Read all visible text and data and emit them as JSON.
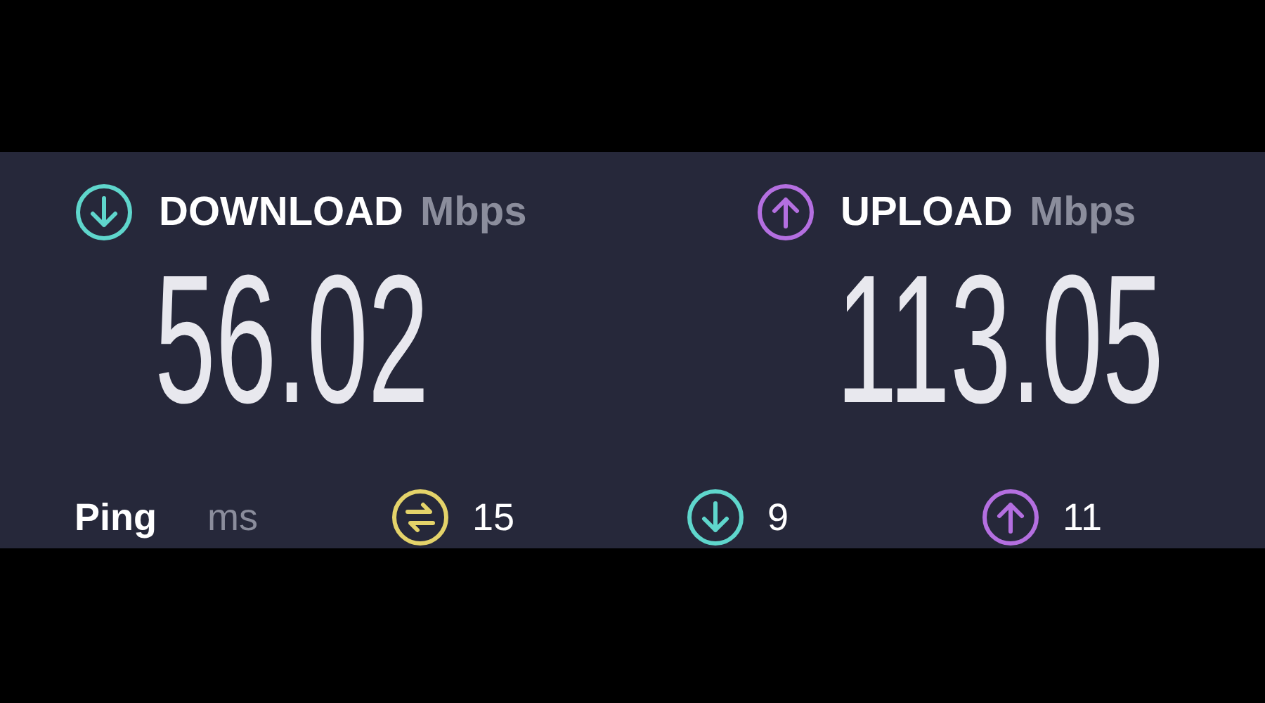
{
  "results": [
    {
      "kind": "download",
      "label": "DOWNLOAD",
      "unit": "Mbps",
      "value": "56.02"
    },
    {
      "kind": "upload",
      "label": "UPLOAD",
      "unit": "Mbps",
      "value": "113.05"
    }
  ],
  "ping": {
    "label": "Ping",
    "unit": "ms",
    "stats": [
      {
        "kind": "ping",
        "value": "15"
      },
      {
        "kind": "download",
        "value": "9"
      },
      {
        "kind": "upload",
        "value": "11"
      }
    ]
  }
}
